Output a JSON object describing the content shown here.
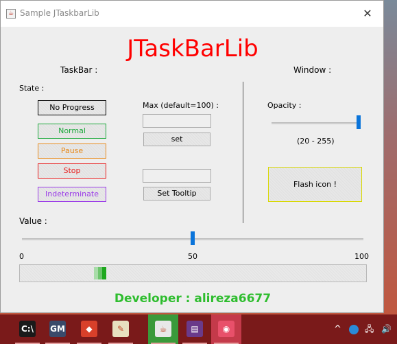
{
  "window": {
    "title": "Sample JTaskbarLib",
    "close_glyph": "✕",
    "icon_glyph": "☕"
  },
  "main": {
    "heading": "JTaskBarLib",
    "taskbar_section": "TaskBar :",
    "window_section": "Window :",
    "state_label": "State :",
    "state_buttons": [
      {
        "label": "No Progress",
        "color": "#000000"
      },
      {
        "label": "Normal",
        "color": "#1aa83a"
      },
      {
        "label": "Pause",
        "color": "#e88a1a"
      },
      {
        "label": "Stop",
        "color": "#e81a1a"
      },
      {
        "label": "Indeterminate",
        "color": "#9a3ae8"
      }
    ],
    "max_label": "Max (default=100) :",
    "max_value": "",
    "set_button": "set",
    "tooltip_value": "",
    "tooltip_button": "Set Tooltip",
    "opacity_label": "Opacity :",
    "opacity_range": "(20 - 255)",
    "opacity_value": 255,
    "flash_button": "Flash icon !",
    "value_label": "Value :",
    "value_slider": 50,
    "value_min": "0",
    "value_mid": "50",
    "value_max": "100",
    "progress_indeterminate": true,
    "developer": "Developer : alireza6677",
    "colors": {
      "title": "#ff0000",
      "developer": "#2ebd2e",
      "accent": "#0a74da",
      "flash_border": "#d8d800"
    }
  },
  "taskbar": {
    "items": [
      {
        "name": "terminal",
        "glyph": "C:\\"
      },
      {
        "name": "game-maker",
        "glyph": "GM"
      },
      {
        "name": "git",
        "glyph": "◆"
      },
      {
        "name": "editor",
        "glyph": "✎"
      },
      {
        "name": "java",
        "glyph": "☕"
      },
      {
        "name": "archive",
        "glyph": "▤"
      },
      {
        "name": "camera",
        "glyph": "◉"
      }
    ],
    "tray": {
      "chevron": "^",
      "network": "🖧",
      "volume": "🔊"
    }
  }
}
